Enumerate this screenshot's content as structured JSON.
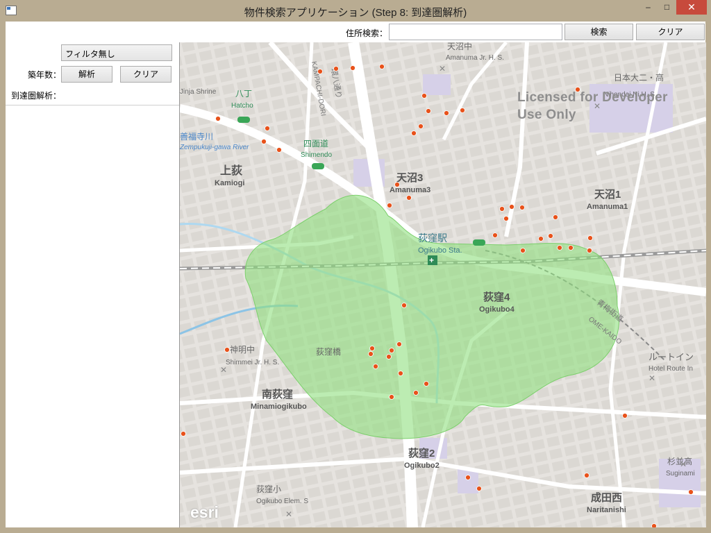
{
  "window": {
    "title": "物件検索アプリケーション (Step 8: 到達圏解析)",
    "min_glyph": "–",
    "max_glyph": "□",
    "close_glyph": "✕"
  },
  "search": {
    "label": "住所検索：",
    "value": "",
    "search_button": "検索",
    "clear_button": "クリア"
  },
  "filter": {
    "label": "築年数：",
    "selected": "フィルタ無し"
  },
  "reach": {
    "label": "到達圏解析：",
    "analyze_button": "解析",
    "clear_button": "クリア"
  },
  "map": {
    "watermark_line1": "Licensed for Developer",
    "watermark_line2": "Use Only",
    "logo": "esri",
    "service_area_color": "#8fe07e",
    "marker_color": "#e8521b",
    "labels": [
      {
        "text": "天沼中",
        "kind": "poi"
      },
      {
        "text": "Amanuma Jr. H. S.",
        "kind": "poi"
      },
      {
        "text": "日本大二・高",
        "kind": "poi"
      },
      {
        "text": "Nihondai Ni H. S",
        "kind": "poi"
      },
      {
        "text": "八丁",
        "kind": "station"
      },
      {
        "text": "Hatcho",
        "kind": "station"
      },
      {
        "text": "善福寺川",
        "kind": "water"
      },
      {
        "text": "Zempukuji-gawa River",
        "kind": "water"
      },
      {
        "text": "四面道",
        "kind": "station"
      },
      {
        "text": "Shimendo",
        "kind": "station"
      },
      {
        "text": "上荻",
        "kind": "district"
      },
      {
        "text": "Kamiogi",
        "kind": "district"
      },
      {
        "text": "天沼3",
        "kind": "district"
      },
      {
        "text": "Amanuma3",
        "kind": "district"
      },
      {
        "text": "天沼1",
        "kind": "district"
      },
      {
        "text": "Amanuma1",
        "kind": "district"
      },
      {
        "text": "荻窪駅",
        "kind": "station"
      },
      {
        "text": "Ogikubo Sta.",
        "kind": "station"
      },
      {
        "text": "荻窪4",
        "kind": "district"
      },
      {
        "text": "Ogikubo4",
        "kind": "district"
      },
      {
        "text": "神明中",
        "kind": "poi"
      },
      {
        "text": "Shimmei Jr. H. S.",
        "kind": "poi"
      },
      {
        "text": "荻窪橋",
        "kind": "poi"
      },
      {
        "text": "南荻窪",
        "kind": "district"
      },
      {
        "text": "Minamiogikubo",
        "kind": "district"
      },
      {
        "text": "荻窪2",
        "kind": "district"
      },
      {
        "text": "Ogikubo2",
        "kind": "district"
      },
      {
        "text": "荻窪小",
        "kind": "poi"
      },
      {
        "text": "Ogikubo Elem. S",
        "kind": "poi"
      },
      {
        "text": "成田西",
        "kind": "district"
      },
      {
        "text": "Naritanishi",
        "kind": "district"
      },
      {
        "text": "杉並高",
        "kind": "poi"
      },
      {
        "text": "Suginami",
        "kind": "poi"
      },
      {
        "text": "ルートイン",
        "kind": "poi"
      },
      {
        "text": "Hotel Route In",
        "kind": "poi"
      },
      {
        "text": "KAMPACHI-DORI",
        "kind": "road"
      },
      {
        "text": "環八通り",
        "kind": "road"
      },
      {
        "text": "OME-KAIDO",
        "kind": "road"
      },
      {
        "text": "青梅街道",
        "kind": "road"
      },
      {
        "text": "Jinja Shrine",
        "kind": "poi"
      }
    ]
  }
}
